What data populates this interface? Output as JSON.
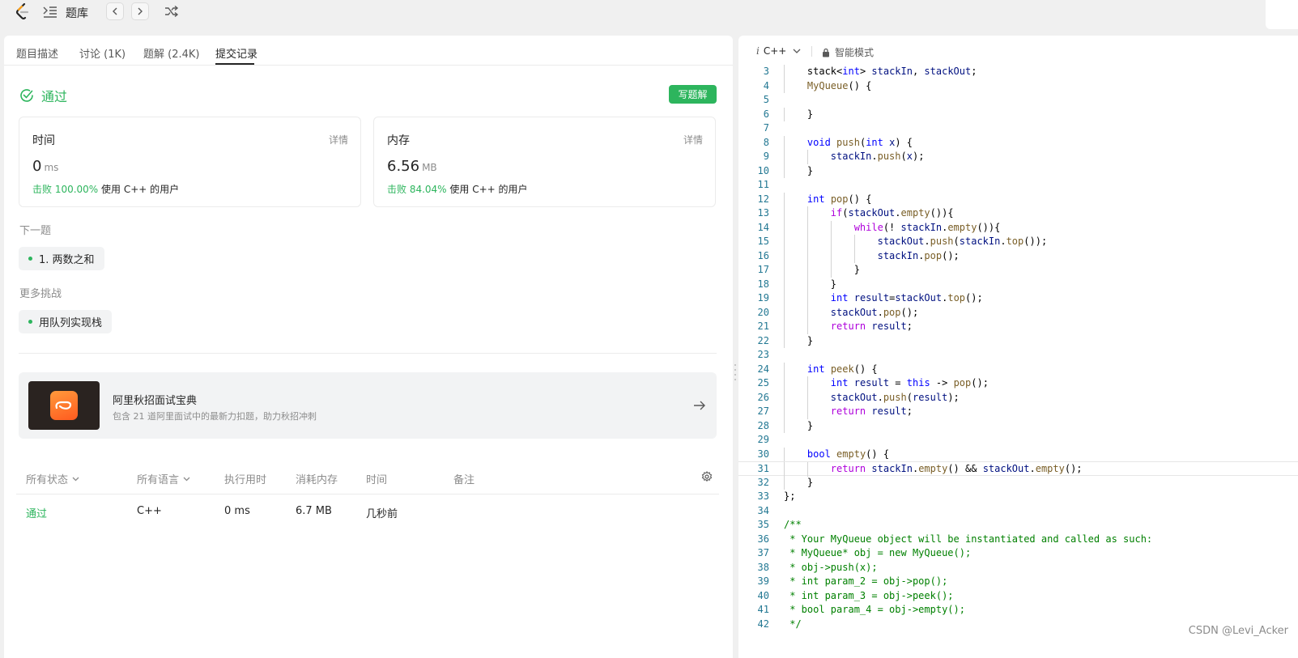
{
  "nav": {
    "title": "题库"
  },
  "tabs": [
    "题目描述",
    "讨论 (1K)",
    "题解 (2.4K)",
    "提交记录"
  ],
  "result": {
    "status": "通过",
    "write_button": "写题解"
  },
  "cards": {
    "time": {
      "label": "时间",
      "detail": "详情",
      "value": "0",
      "unit": "ms",
      "beat_pct": "击败 100.00%",
      "beat_suffix": "使用 C++ 的用户"
    },
    "memory": {
      "label": "内存",
      "detail": "详情",
      "value": "6.56",
      "unit": "MB",
      "beat_pct": "击败 84.04%",
      "beat_suffix": "使用 C++ 的用户"
    }
  },
  "next": {
    "label": "下一题",
    "item": "1. 两数之和"
  },
  "more": {
    "label": "更多挑战",
    "item": "用队列实现栈"
  },
  "promo": {
    "title": "阿里秋招面试宝典",
    "desc": "包含 21 道阿里面试中的最新力扣题，助力秋招冲刺"
  },
  "table": {
    "headers": [
      "所有状态",
      "所有语言",
      "执行用时",
      "消耗内存",
      "时间",
      "备注"
    ],
    "row": {
      "status": "通过",
      "lang": "C++",
      "time": "0 ms",
      "memory": "6.7 MB",
      "when": "几秒前"
    }
  },
  "editor": {
    "lang_icon": "i",
    "language": "C++",
    "mode": "智能模式",
    "current_line": 31,
    "lines": [
      {
        "n": "3",
        "code": "    stack<int> stackIn, stackOut;"
      },
      {
        "n": "4",
        "code": "    MyQueue() {"
      },
      {
        "n": "5",
        "code": ""
      },
      {
        "n": "6",
        "code": "    }"
      },
      {
        "n": "7",
        "code": ""
      },
      {
        "n": "8",
        "code": "    void push(int x) {"
      },
      {
        "n": "9",
        "code": "        stackIn.push(x);"
      },
      {
        "n": "10",
        "code": "    }"
      },
      {
        "n": "11",
        "code": ""
      },
      {
        "n": "12",
        "code": "    int pop() {"
      },
      {
        "n": "13",
        "code": "        if(stackOut.empty()){"
      },
      {
        "n": "14",
        "code": "            while(! stackIn.empty()){"
      },
      {
        "n": "15",
        "code": "                stackOut.push(stackIn.top());"
      },
      {
        "n": "16",
        "code": "                stackIn.pop();"
      },
      {
        "n": "17",
        "code": "            }"
      },
      {
        "n": "18",
        "code": "        }"
      },
      {
        "n": "19",
        "code": "        int result=stackOut.top();"
      },
      {
        "n": "20",
        "code": "        stackOut.pop();"
      },
      {
        "n": "21",
        "code": "        return result;"
      },
      {
        "n": "22",
        "code": "    }"
      },
      {
        "n": "23",
        "code": ""
      },
      {
        "n": "24",
        "code": "    int peek() {"
      },
      {
        "n": "25",
        "code": "        int result = this -> pop();"
      },
      {
        "n": "26",
        "code": "        stackOut.push(result);"
      },
      {
        "n": "27",
        "code": "        return result;"
      },
      {
        "n": "28",
        "code": "    }"
      },
      {
        "n": "29",
        "code": ""
      },
      {
        "n": "30",
        "code": "    bool empty() {"
      },
      {
        "n": "31",
        "code": "        return stackIn.empty() && stackOut.empty();"
      },
      {
        "n": "32",
        "code": "    }"
      },
      {
        "n": "33",
        "code": "};"
      },
      {
        "n": "34",
        "code": ""
      },
      {
        "n": "35",
        "code": "/**"
      },
      {
        "n": "36",
        "code": " * Your MyQueue object will be instantiated and called as such:"
      },
      {
        "n": "37",
        "code": " * MyQueue* obj = new MyQueue();"
      },
      {
        "n": "38",
        "code": " * obj->push(x);"
      },
      {
        "n": "39",
        "code": " * int param_2 = obj->pop();"
      },
      {
        "n": "40",
        "code": " * int param_3 = obj->peek();"
      },
      {
        "n": "41",
        "code": " * bool param_4 = obj->empty();"
      },
      {
        "n": "42",
        "code": " */"
      }
    ]
  },
  "watermark": "CSDN @Levi_Acker",
  "colors": {
    "accent_green": "#2db55d",
    "line_number": "#237893",
    "keyword": "#0000ff",
    "control": "#af00db",
    "comment": "#008000"
  }
}
